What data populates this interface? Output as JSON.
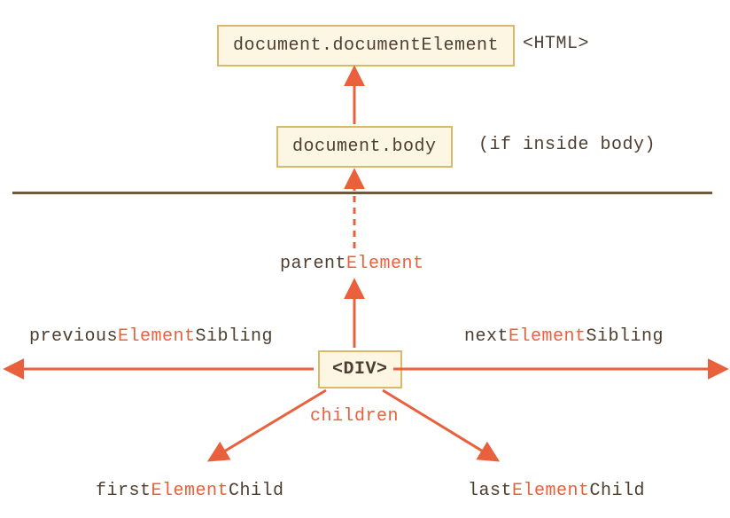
{
  "colors": {
    "text": "#4d3e2f",
    "highlight": "#e8603c",
    "box_bg": "#fdf6e3",
    "box_border": "#d8b96a",
    "divider": "#6e5a3a",
    "arrow": "#e8603c"
  },
  "boxes": {
    "documentElement": {
      "text": "document.documentElement",
      "note": "<HTML>"
    },
    "body": {
      "text": "document.body",
      "note": "(if inside body)"
    },
    "div": {
      "text": "<DIV>"
    }
  },
  "labels": {
    "parentElement": {
      "prefix": "parent",
      "hl": "Element",
      "suffix": ""
    },
    "previousElementSibling": {
      "prefix": "previous",
      "hl": "Element",
      "suffix": "Sibling"
    },
    "nextElementSibling": {
      "prefix": "next",
      "hl": "Element",
      "suffix": "Sibling"
    },
    "children": {
      "prefix": "",
      "hl": "children",
      "suffix": ""
    },
    "firstElementChild": {
      "prefix": "first",
      "hl": "Element",
      "suffix": "Child"
    },
    "lastElementChild": {
      "prefix": "last",
      "hl": "Element",
      "suffix": "Child"
    }
  }
}
